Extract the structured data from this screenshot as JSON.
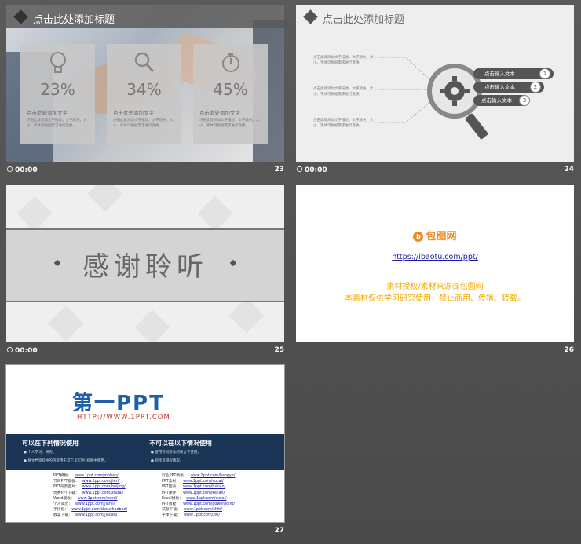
{
  "slides": [
    {
      "number": "23",
      "time": "00:00",
      "title": "点击此处添加标题",
      "cards": [
        {
          "icon": "lightbulb-icon",
          "percent": "23%",
          "heading": "点击此处添加文字",
          "body": "点击此处添加文字描述，文字颜色、大小、字体可根据需求进行变换。"
        },
        {
          "icon": "magnifier-icon",
          "percent": "34%",
          "heading": "点击此处添加文字",
          "body": "点击此处添加文字描述，文字颜色、大小、字体可根据需求进行变换。"
        },
        {
          "icon": "stopwatch-icon",
          "percent": "45%",
          "heading": "点击此处添加文字",
          "body": "点击此处添加文字描述，文字颜色、大小、字体可根据需求进行变换。"
        }
      ]
    },
    {
      "number": "24",
      "time": "00:00",
      "title": "点击此处添加标题",
      "left_texts": [
        "点击此处添加文字描述，文字颜色、大小、字体可根据需求进行变换。",
        "点击此处添加文字描述，文字颜色、大小、字体可根据需求进行变换。",
        "点击此处添加文字描述，文字颜色、大小、字体可根据需求进行变换。"
      ],
      "pills": [
        {
          "label": "点击输入文本",
          "num": "1"
        },
        {
          "label": "点击输入文本",
          "num": "2"
        },
        {
          "label": "点击输入文本",
          "num": "3"
        }
      ]
    },
    {
      "number": "25",
      "time": "00:00",
      "thanks": "感谢聆听"
    },
    {
      "number": "26",
      "logo": "包图网",
      "logo_glyph": "b",
      "url": "https://ibaotu.com/ppt/",
      "line1": "素材授权/素材来源@包图网",
      "line2": "本素材仅供学习研究使用，禁止商用、传播、转载。"
    },
    {
      "number": "27",
      "logo": "第一PPT",
      "sub": "HTTP://WWW.1PPT.COM",
      "can_title": "可以在下列情况使用",
      "can_items": [
        "● 个人学习、研究。",
        "● 将文档资料中的内容用于其它 幻灯片/视频中使用。"
      ],
      "cannot_title": "不可以在以下情况使用",
      "cannot_items": [
        "● 使用有损形象的场合下使用。",
        "● 则涉及侵权情况。"
      ],
      "links_left": [
        {
          "k": "PPT模板：",
          "v": "www.1ppt.com/moban/"
        },
        {
          "k": "节日PPT模板：",
          "v": "www.1ppt.com/jieri/"
        },
        {
          "k": "PPT背景图片：",
          "v": "www.1ppt.com/beijing/"
        },
        {
          "k": "优秀PPT下载：",
          "v": "www.1ppt.com/xiazai/"
        },
        {
          "k": "Word模板：",
          "v": "www.1ppt.com/word/"
        },
        {
          "k": "个人简历：",
          "v": "www.1ppt.com/jianli/"
        },
        {
          "k": "手抄报：",
          "v": "www.1ppt.com/shouchaobao/"
        },
        {
          "k": "教案下载：",
          "v": "www.1ppt.com/jiaoan/"
        }
      ],
      "links_right": [
        {
          "k": "行业PPT模板：",
          "v": "www.1ppt.com/hangye/"
        },
        {
          "k": "PPT素材：",
          "v": "www.1ppt.com/sucai/"
        },
        {
          "k": "PPT图表：",
          "v": "www.1ppt.com/tubiao/"
        },
        {
          "k": "PPT课件：",
          "v": "www.1ppt.com/kejian/"
        },
        {
          "k": "Excel模板：",
          "v": "www.1ppt.com/excel/"
        },
        {
          "k": "PPT教程：",
          "v": "www.1ppt.com/powerpoint/"
        },
        {
          "k": "试题下载：",
          "v": "www.1ppt.com/shiti/"
        },
        {
          "k": "字体下载：",
          "v": "www.1ppt.com/ziti/"
        }
      ]
    }
  ],
  "colors": {
    "panel_bg": "#4f4f4f",
    "accent_dark": "#555555",
    "orange": "#f08a24",
    "navy": "#1b3556"
  }
}
